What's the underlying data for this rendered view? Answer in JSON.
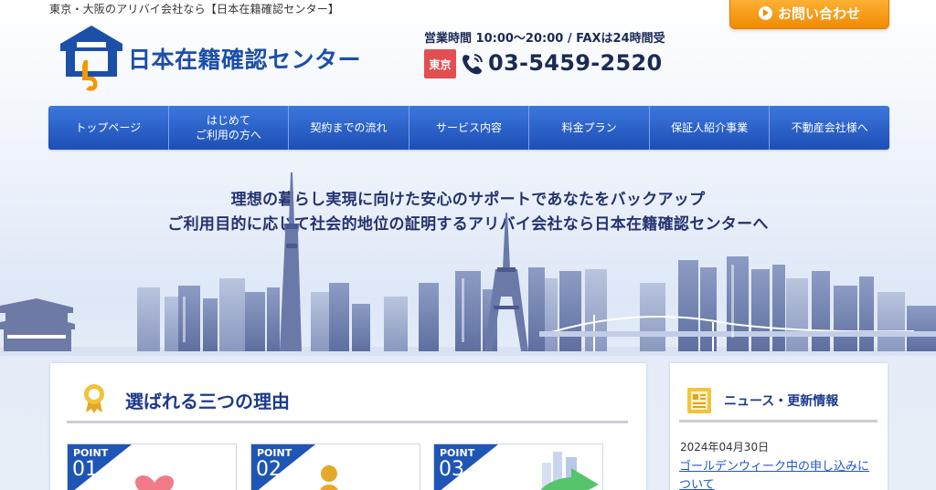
{
  "header": {
    "tagline": "東京・大阪のアリバイ会社なら【日本在籍確認センター】",
    "contact_button": "お問い合わせ",
    "logo_text": "日本在籍確認センター",
    "hours": "営業時間 10:00〜20:00 / FAXは24時間受",
    "region_badge": "東京",
    "phone": "03-5459-2520"
  },
  "nav": {
    "items": [
      {
        "label": "トップページ"
      },
      {
        "label": "はじめて\nご利用の方へ"
      },
      {
        "label": "契約までの流れ"
      },
      {
        "label": "サービス内容"
      },
      {
        "label": "料金プラン"
      },
      {
        "label": "保証人紹介事業"
      },
      {
        "label": "不動産会社様へ"
      }
    ]
  },
  "hero": {
    "line1": "理想の暮らし実現に向けた安心のサポートであなたをバックアップ",
    "line2": "ご利用目的に応じて社会的地位の証明するアリバイ会社なら日本在籍確認センターへ"
  },
  "reasons": {
    "title": "選ばれる三つの理由",
    "points": [
      {
        "label": "POINT",
        "number": "01"
      },
      {
        "label": "POINT",
        "number": "02"
      },
      {
        "label": "POINT",
        "number": "03"
      }
    ]
  },
  "news": {
    "title": "ニュース・更新情報",
    "items": [
      {
        "date": "2024年04月30日",
        "title": "ゴールデンウィーク中の申し込みについて"
      }
    ]
  },
  "colors": {
    "brand_blue": "#1c4fa8",
    "nav_blue": "#2a62c8",
    "accent_orange": "#f39800",
    "badge_red": "#e24f53"
  },
  "icons": [
    "play-circle-icon",
    "house-logo-icon",
    "phone-icon",
    "ribbon-award-icon",
    "newspaper-icon",
    "heart-icon",
    "person-icon",
    "arrow-icon"
  ]
}
